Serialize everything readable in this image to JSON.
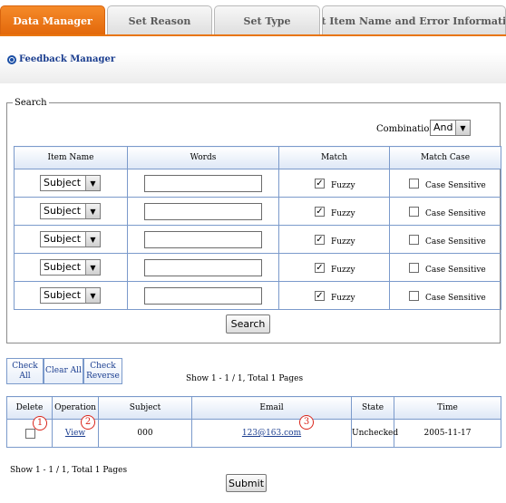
{
  "tabs": [
    "Data Manager",
    "Set Reason",
    "Set Type",
    "Set Item Name and Error Information"
  ],
  "section_title": "Feedback Manager",
  "search": {
    "legend": "Search",
    "combination_label": "Combination:",
    "combination_value": "And",
    "headers": [
      "Item Name",
      "Words",
      "Match",
      "Match Case"
    ],
    "rows": [
      {
        "item": "Subject",
        "words": "",
        "match_label": "Fuzzy",
        "match_checked": true,
        "case_label": "Case Sensitive",
        "case_checked": false
      },
      {
        "item": "Subject",
        "words": "",
        "match_label": "Fuzzy",
        "match_checked": true,
        "case_label": "Case Sensitive",
        "case_checked": false
      },
      {
        "item": "Subject",
        "words": "",
        "match_label": "Fuzzy",
        "match_checked": true,
        "case_label": "Case Sensitive",
        "case_checked": false
      },
      {
        "item": "Subject",
        "words": "",
        "match_label": "Fuzzy",
        "match_checked": true,
        "case_label": "Case Sensitive",
        "case_checked": false
      },
      {
        "item": "Subject",
        "words": "",
        "match_label": "Fuzzy",
        "match_checked": true,
        "case_label": "Case Sensitive",
        "case_checked": false
      }
    ],
    "search_button": "Search"
  },
  "check_buttons": {
    "check_all_line1": "Check",
    "check_all_line2": "All",
    "clear_all": "Clear All",
    "check_reverse_line1": "Check",
    "check_reverse_line2": "Reverse"
  },
  "pagination_top": "Show 1 - 1 / 1, Total 1 Pages",
  "results": {
    "headers": [
      "Delete",
      "Operation",
      "Subject",
      "Email",
      "State",
      "Time"
    ],
    "rows": [
      {
        "delete_checked": false,
        "operation": "View",
        "subject": "000",
        "email": "123@163.com",
        "state": "Unchecked",
        "time": "2005-11-17"
      }
    ]
  },
  "markers": [
    "1",
    "2",
    "3"
  ],
  "pagination_bottom": "Show 1 - 1 / 1, Total 1 Pages",
  "submit_button": "Submit",
  "colors": {
    "active_tab": "#e8750f",
    "link": "#1a3d8f",
    "table_border": "#7b9acb",
    "marker": "#d9261c"
  }
}
